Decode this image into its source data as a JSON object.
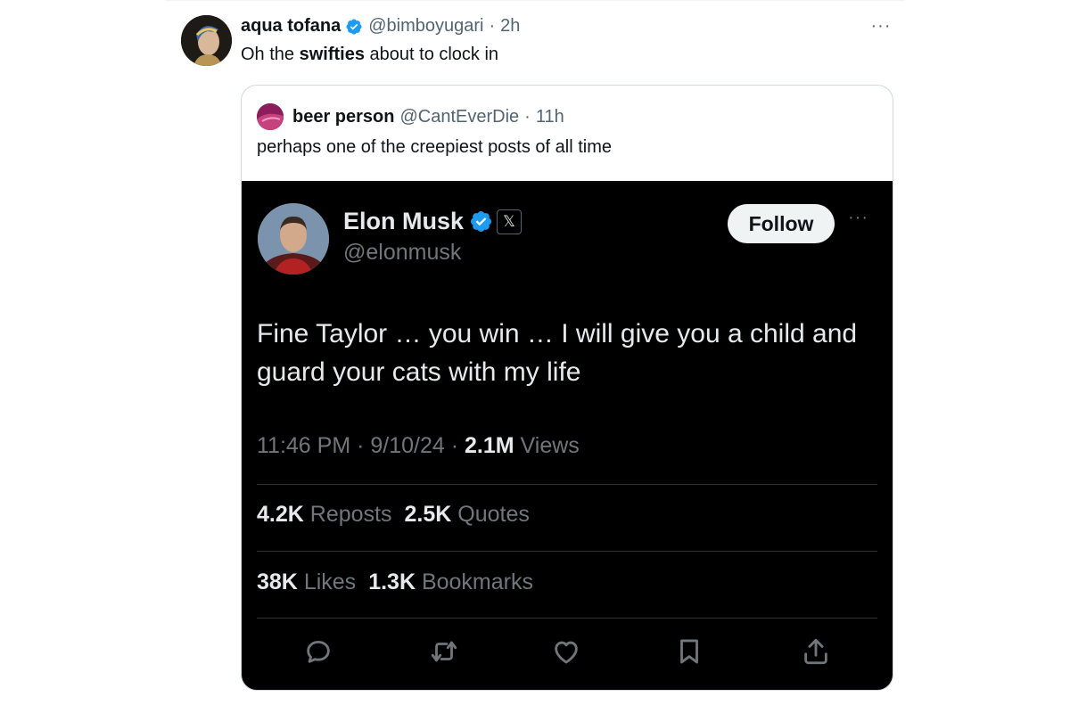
{
  "post": {
    "author_name": "aqua tofana",
    "author_handle": "@bimboyugari",
    "separator": "·",
    "time": "2h",
    "more": "···",
    "text_before": "Oh the ",
    "text_bold": "swifties",
    "text_after": " about to clock in"
  },
  "quote": {
    "author_name": "beer person",
    "author_handle": "@CantEverDie",
    "separator": "·",
    "time": "11h",
    "text": "perhaps one of the creepiest posts of all time"
  },
  "embed": {
    "author_name": "Elon Musk",
    "author_handle": "@elonmusk",
    "x_badge": "𝕏",
    "follow_label": "Follow",
    "more": "···",
    "text": "Fine Taylor … you win … I will give you a child and guard your cats with my life",
    "meta_time": "11:46 PM · 9/10/24 · ",
    "views_count": "2.1M",
    "views_label": " Views",
    "reposts_count": "4.2K",
    "reposts_label": " Reposts",
    "quotes_count": "2.5K",
    "quotes_label": " Quotes",
    "likes_count": "38K",
    "likes_label": " Likes",
    "bookmarks_count": "1.3K",
    "bookmarks_label": " Bookmarks"
  },
  "colors": {
    "verified_blue": "#1d9bf0",
    "embed_background": "#000000",
    "secondary_text": "#536471"
  },
  "icons": [
    "verified-badge-icon",
    "more-icon",
    "x-logo-icon",
    "reply-icon",
    "repost-icon",
    "like-icon",
    "bookmark-icon",
    "share-icon"
  ]
}
